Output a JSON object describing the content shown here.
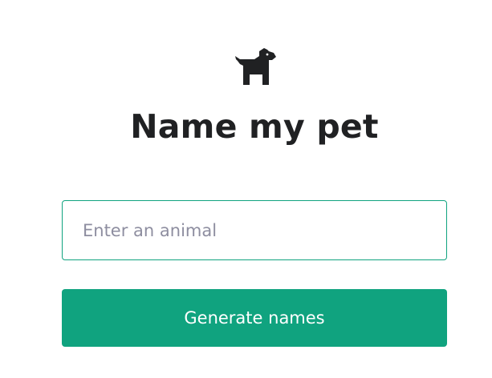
{
  "header": {
    "icon": "dog-icon",
    "title": "Name my pet"
  },
  "form": {
    "animal_input": {
      "value": "",
      "placeholder": "Enter an animal"
    },
    "submit_label": "Generate names"
  },
  "colors": {
    "accent": "#10a37f",
    "title_text": "#202123",
    "placeholder_text": "#8e8ea0",
    "button_text": "#ffffff"
  }
}
